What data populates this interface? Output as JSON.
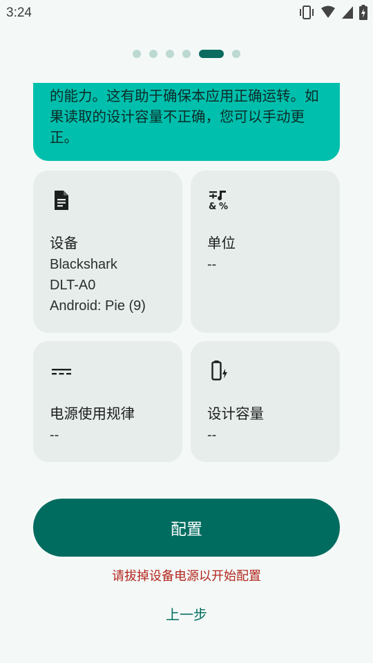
{
  "status_bar": {
    "time": "3:24",
    "icons": [
      "vibrate-icon",
      "wifi-icon",
      "signal-icon",
      "battery-charging-icon"
    ]
  },
  "pager": {
    "total": 6,
    "active_index": 4
  },
  "intro": {
    "text": "的能力。这有助于确保本应用正确运转。如果读取的设计容量不正确，您可以手动更正。"
  },
  "tiles": {
    "device": {
      "icon": "document-icon",
      "title": "设备",
      "value": "Blackshark\nDLT-A0\nAndroid: Pie (9)"
    },
    "unit": {
      "icon": "math-symbols-icon",
      "title": "单位",
      "value": "--"
    },
    "power_pattern": {
      "icon": "power-input-icon",
      "title": "电源使用规律",
      "value": "--"
    },
    "design_capacity": {
      "icon": "battery-charging-outline-icon",
      "title": "设计容量",
      "value": "--"
    }
  },
  "actions": {
    "configure_label": "配置",
    "warning_text": "请拔掉设备电源以开始配置",
    "back_label": "上一步"
  },
  "colors": {
    "background": "#f4f9f7",
    "intro_card": "#00bfad",
    "tile": "#e7edeb",
    "primary": "#006c5f",
    "warning": "#b3261e",
    "dot_inactive": "#bcd9d2"
  }
}
